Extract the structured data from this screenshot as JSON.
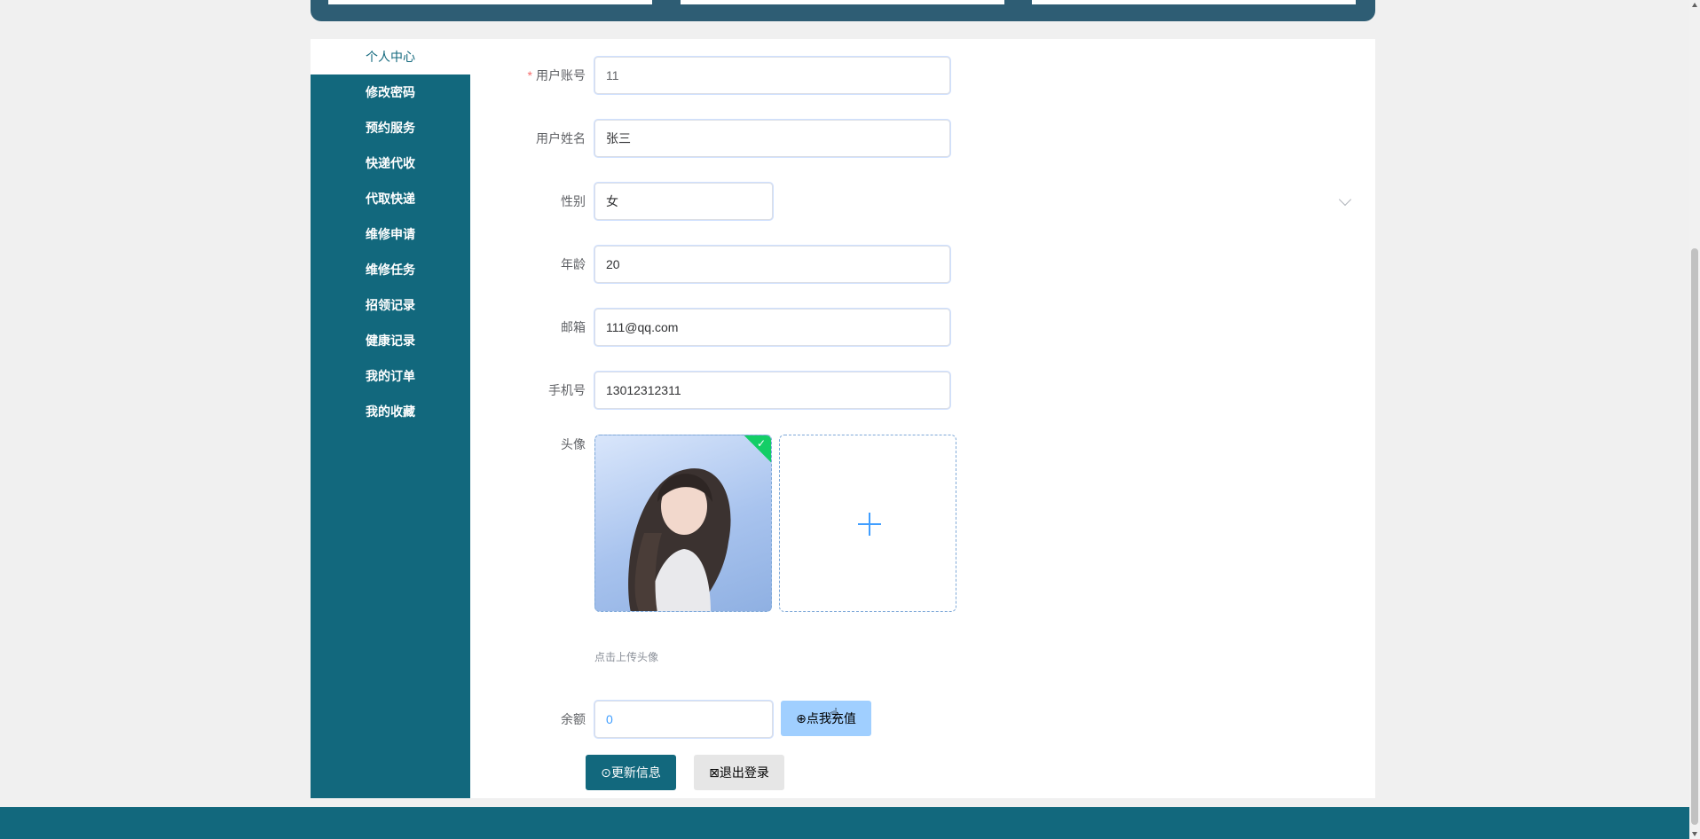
{
  "sidebar": {
    "items": [
      {
        "label": "个人中心",
        "active": true
      },
      {
        "label": "修改密码"
      },
      {
        "label": "预约服务"
      },
      {
        "label": "快递代收"
      },
      {
        "label": "代取快递"
      },
      {
        "label": "维修申请"
      },
      {
        "label": "维修任务"
      },
      {
        "label": "招领记录"
      },
      {
        "label": "健康记录"
      },
      {
        "label": "我的订单"
      },
      {
        "label": "我的收藏"
      }
    ]
  },
  "form": {
    "account": {
      "label": "用户账号",
      "value": "11",
      "required": "*"
    },
    "name": {
      "label": "用户姓名",
      "value": "张三"
    },
    "gender": {
      "label": "性别",
      "value": "女"
    },
    "age": {
      "label": "年龄",
      "value": "20"
    },
    "email": {
      "label": "邮箱",
      "value": "111@qq.com"
    },
    "phone": {
      "label": "手机号",
      "value": "13012312311"
    },
    "avatar": {
      "label": "头像",
      "hint": "点击上传头像"
    },
    "balance": {
      "label": "余额",
      "value": "0"
    }
  },
  "buttons": {
    "recharge": "点我充值",
    "update": "更新信息",
    "logout": "退出登录"
  },
  "colors": {
    "primary": "#12687d",
    "success": "#13ce66",
    "link": "#409eff"
  }
}
